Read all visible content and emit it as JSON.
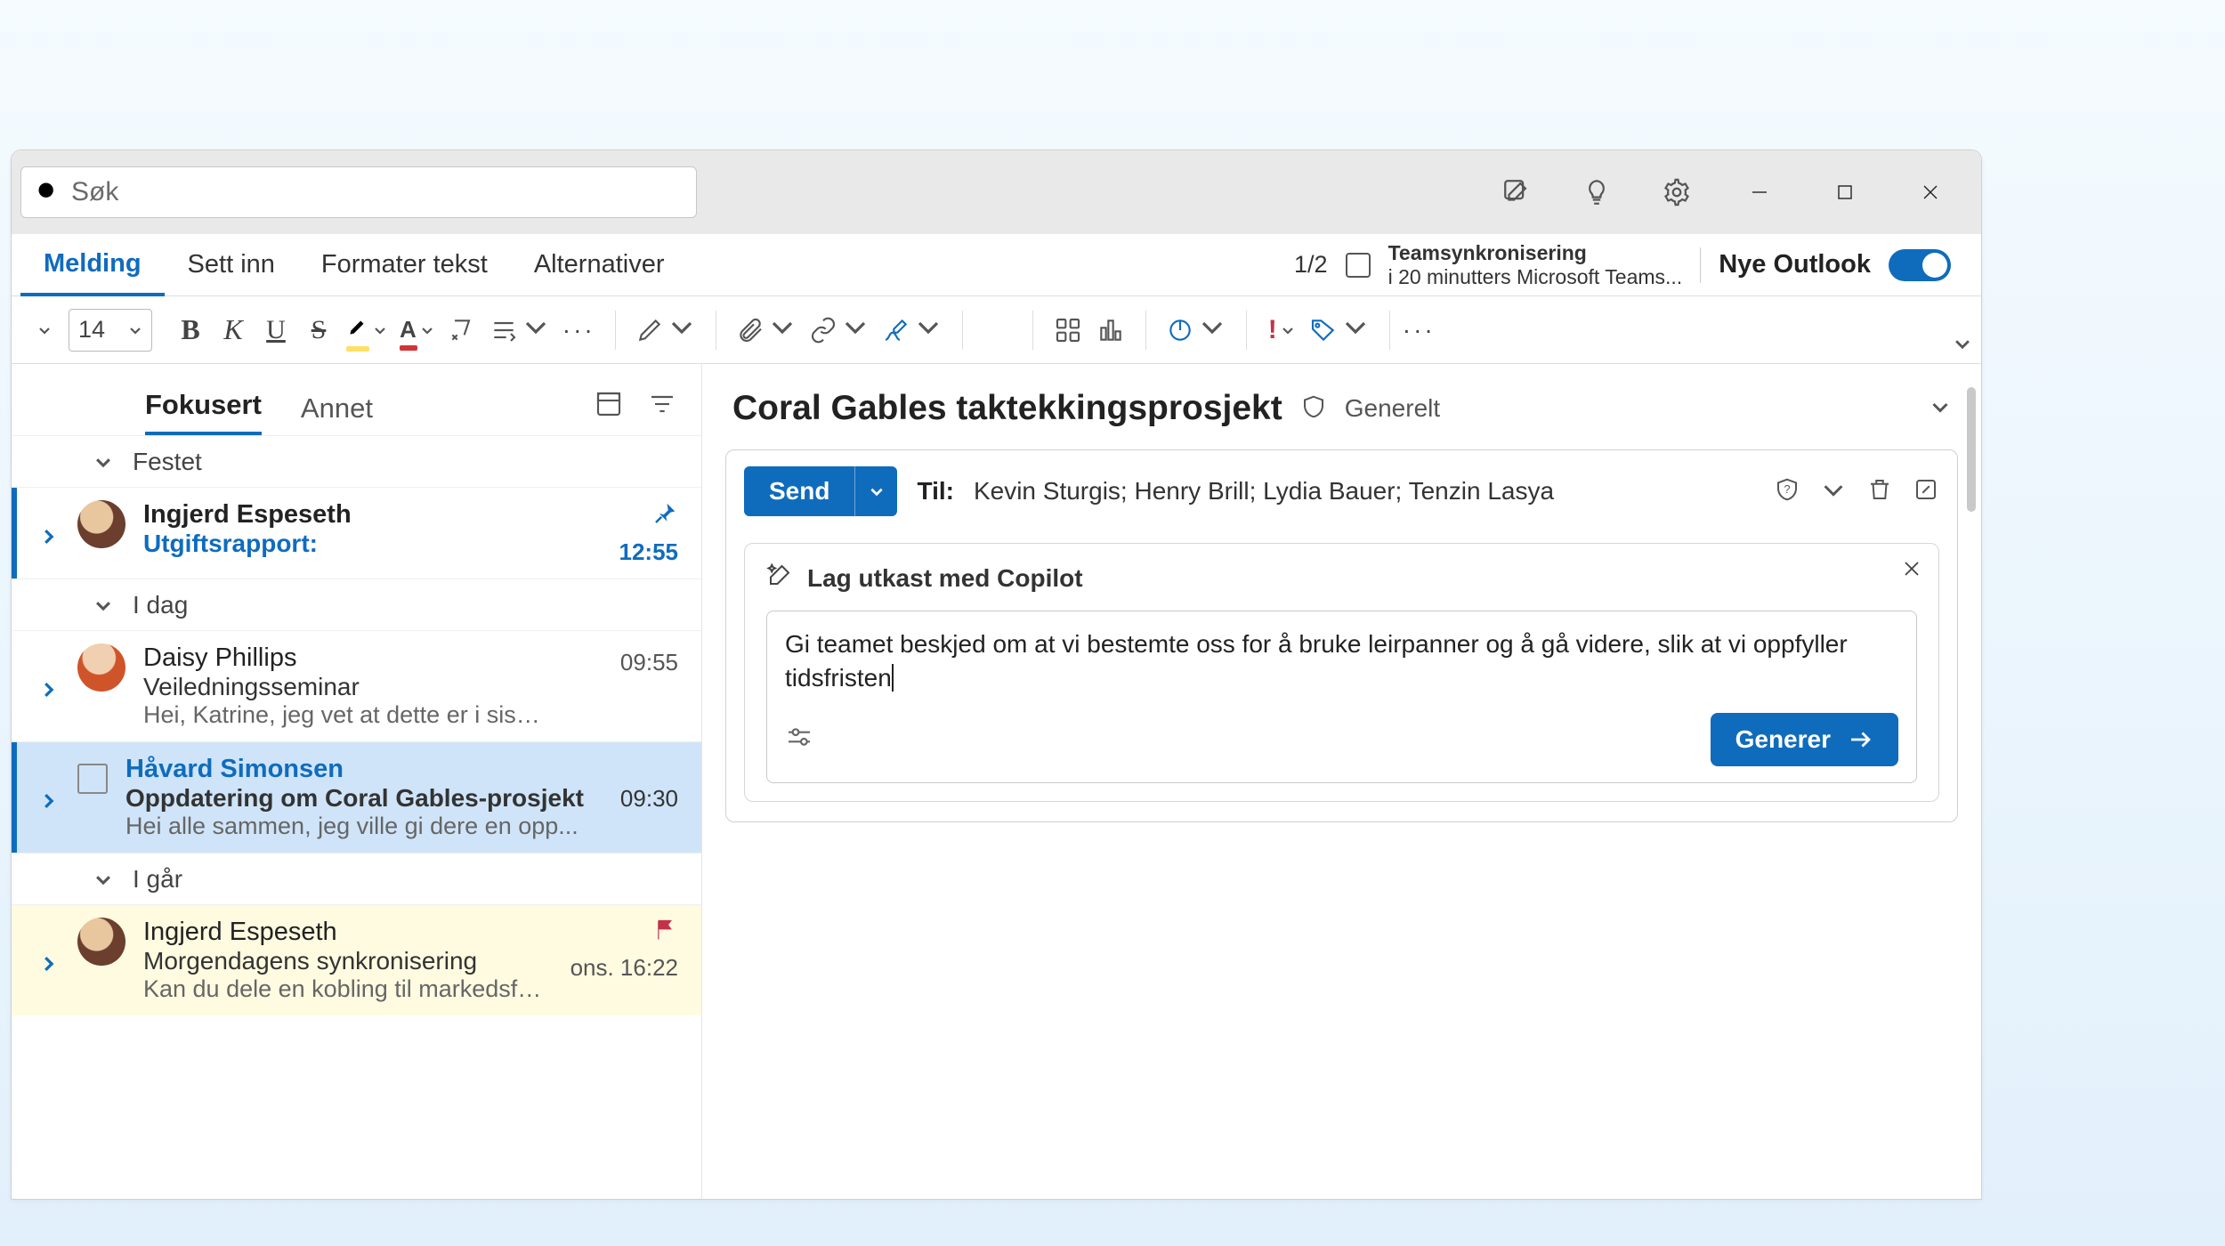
{
  "search": {
    "placeholder": "Søk"
  },
  "ribbon": {
    "tabs": {
      "melding": "Melding",
      "settinn": "Sett inn",
      "formater": "Formater tekst",
      "alternativer": "Alternativer"
    },
    "page": "1/2",
    "sync_title": "Teamsynkronisering",
    "sync_sub": "i 20 minutters Microsoft Teams...",
    "toggle_label": "Nye Outlook"
  },
  "toolbar": {
    "font_size": "14"
  },
  "msglist": {
    "tabs": {
      "fokusert": "Fokusert",
      "annet": "Annet"
    },
    "sections": {
      "festet": "Festet",
      "idag": "I dag",
      "igaar": "I går"
    },
    "pinned": {
      "sender": "Ingjerd Espeseth",
      "subject": "Utgiftsrapport:",
      "time": "12:55"
    },
    "row1": {
      "sender": "Daisy Phillips",
      "subject": "Veiledningsseminar",
      "preview": "Hei, Katrine, jeg vet at dette er i siste liten...",
      "time": "09:55"
    },
    "row2": {
      "sender": "Håvard Simonsen",
      "subject": "Oppdatering om Coral Gables-prosjekt",
      "preview": "Hei alle sammen, jeg ville gi dere en opp...",
      "time": "09:30"
    },
    "row3": {
      "sender": "Ingjerd Espeseth",
      "subject": "Morgendagens synkronisering",
      "preview": "Kan du dele en kobling til markedsføringen...",
      "time": "ons. 16:22"
    }
  },
  "reading": {
    "subject": "Coral Gables taktekkingsprosjekt",
    "tag": "Generelt",
    "send": "Send",
    "to_label": "Til:",
    "to_names": "Kevin Sturgis; Henry Brill; Lydia Bauer; Tenzin Lasya",
    "copilot_title": "Lag utkast med Copilot",
    "copilot_text": "Gi teamet beskjed om at vi bestemte oss for å bruke leirpanner og å gå videre, slik at vi oppfyller tidsfristen",
    "generate": "Generer"
  }
}
